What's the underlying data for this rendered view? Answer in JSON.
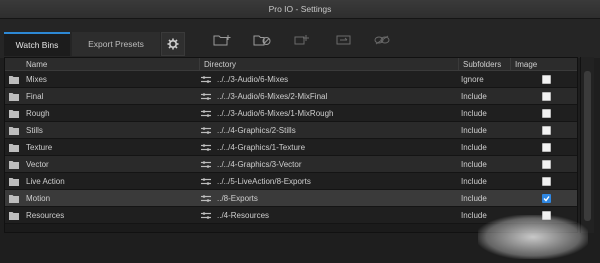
{
  "window": {
    "title": "Pro IO - Settings"
  },
  "tabs": [
    {
      "label": "Watch Bins",
      "active": true
    },
    {
      "label": "Export Presets",
      "active": false
    }
  ],
  "toolbar": {
    "icons": [
      "gear-icon",
      "new-folder-icon",
      "remove-folder-icon",
      "add-item-icon",
      "tag-icon",
      "unlink-icon"
    ]
  },
  "table": {
    "columns": [
      "Name",
      "Directory",
      "Subfolders",
      "Image Sequences"
    ],
    "rows": [
      {
        "name": "Mixes",
        "directory": "../../3-Audio/6-Mixes",
        "subfolders": "Ignore",
        "image_sequences": false
      },
      {
        "name": "Final",
        "directory": "../../3-Audio/6-Mixes/2-MixFinal",
        "subfolders": "Include",
        "image_sequences": false
      },
      {
        "name": "Rough",
        "directory": "../../3-Audio/6-Mixes/1-MixRough",
        "subfolders": "Include",
        "image_sequences": false
      },
      {
        "name": "Stills",
        "directory": "../../4-Graphics/2-Stills",
        "subfolders": "Include",
        "image_sequences": false
      },
      {
        "name": "Texture",
        "directory": "../../4-Graphics/1-Texture",
        "subfolders": "Include",
        "image_sequences": false
      },
      {
        "name": "Vector",
        "directory": "../../4-Graphics/3-Vector",
        "subfolders": "Include",
        "image_sequences": false
      },
      {
        "name": "Live Action",
        "directory": "../../5-LiveAction/8-Exports",
        "subfolders": "Include",
        "image_sequences": false
      },
      {
        "name": "Motion",
        "directory": "../8-Exports",
        "subfolders": "Include",
        "image_sequences": true
      },
      {
        "name": "Resources",
        "directory": "../4-Resources",
        "subfolders": "Include",
        "image_sequences": false
      }
    ]
  },
  "colors": {
    "accent": "#2f87e2",
    "background": "#1e1e1e"
  }
}
